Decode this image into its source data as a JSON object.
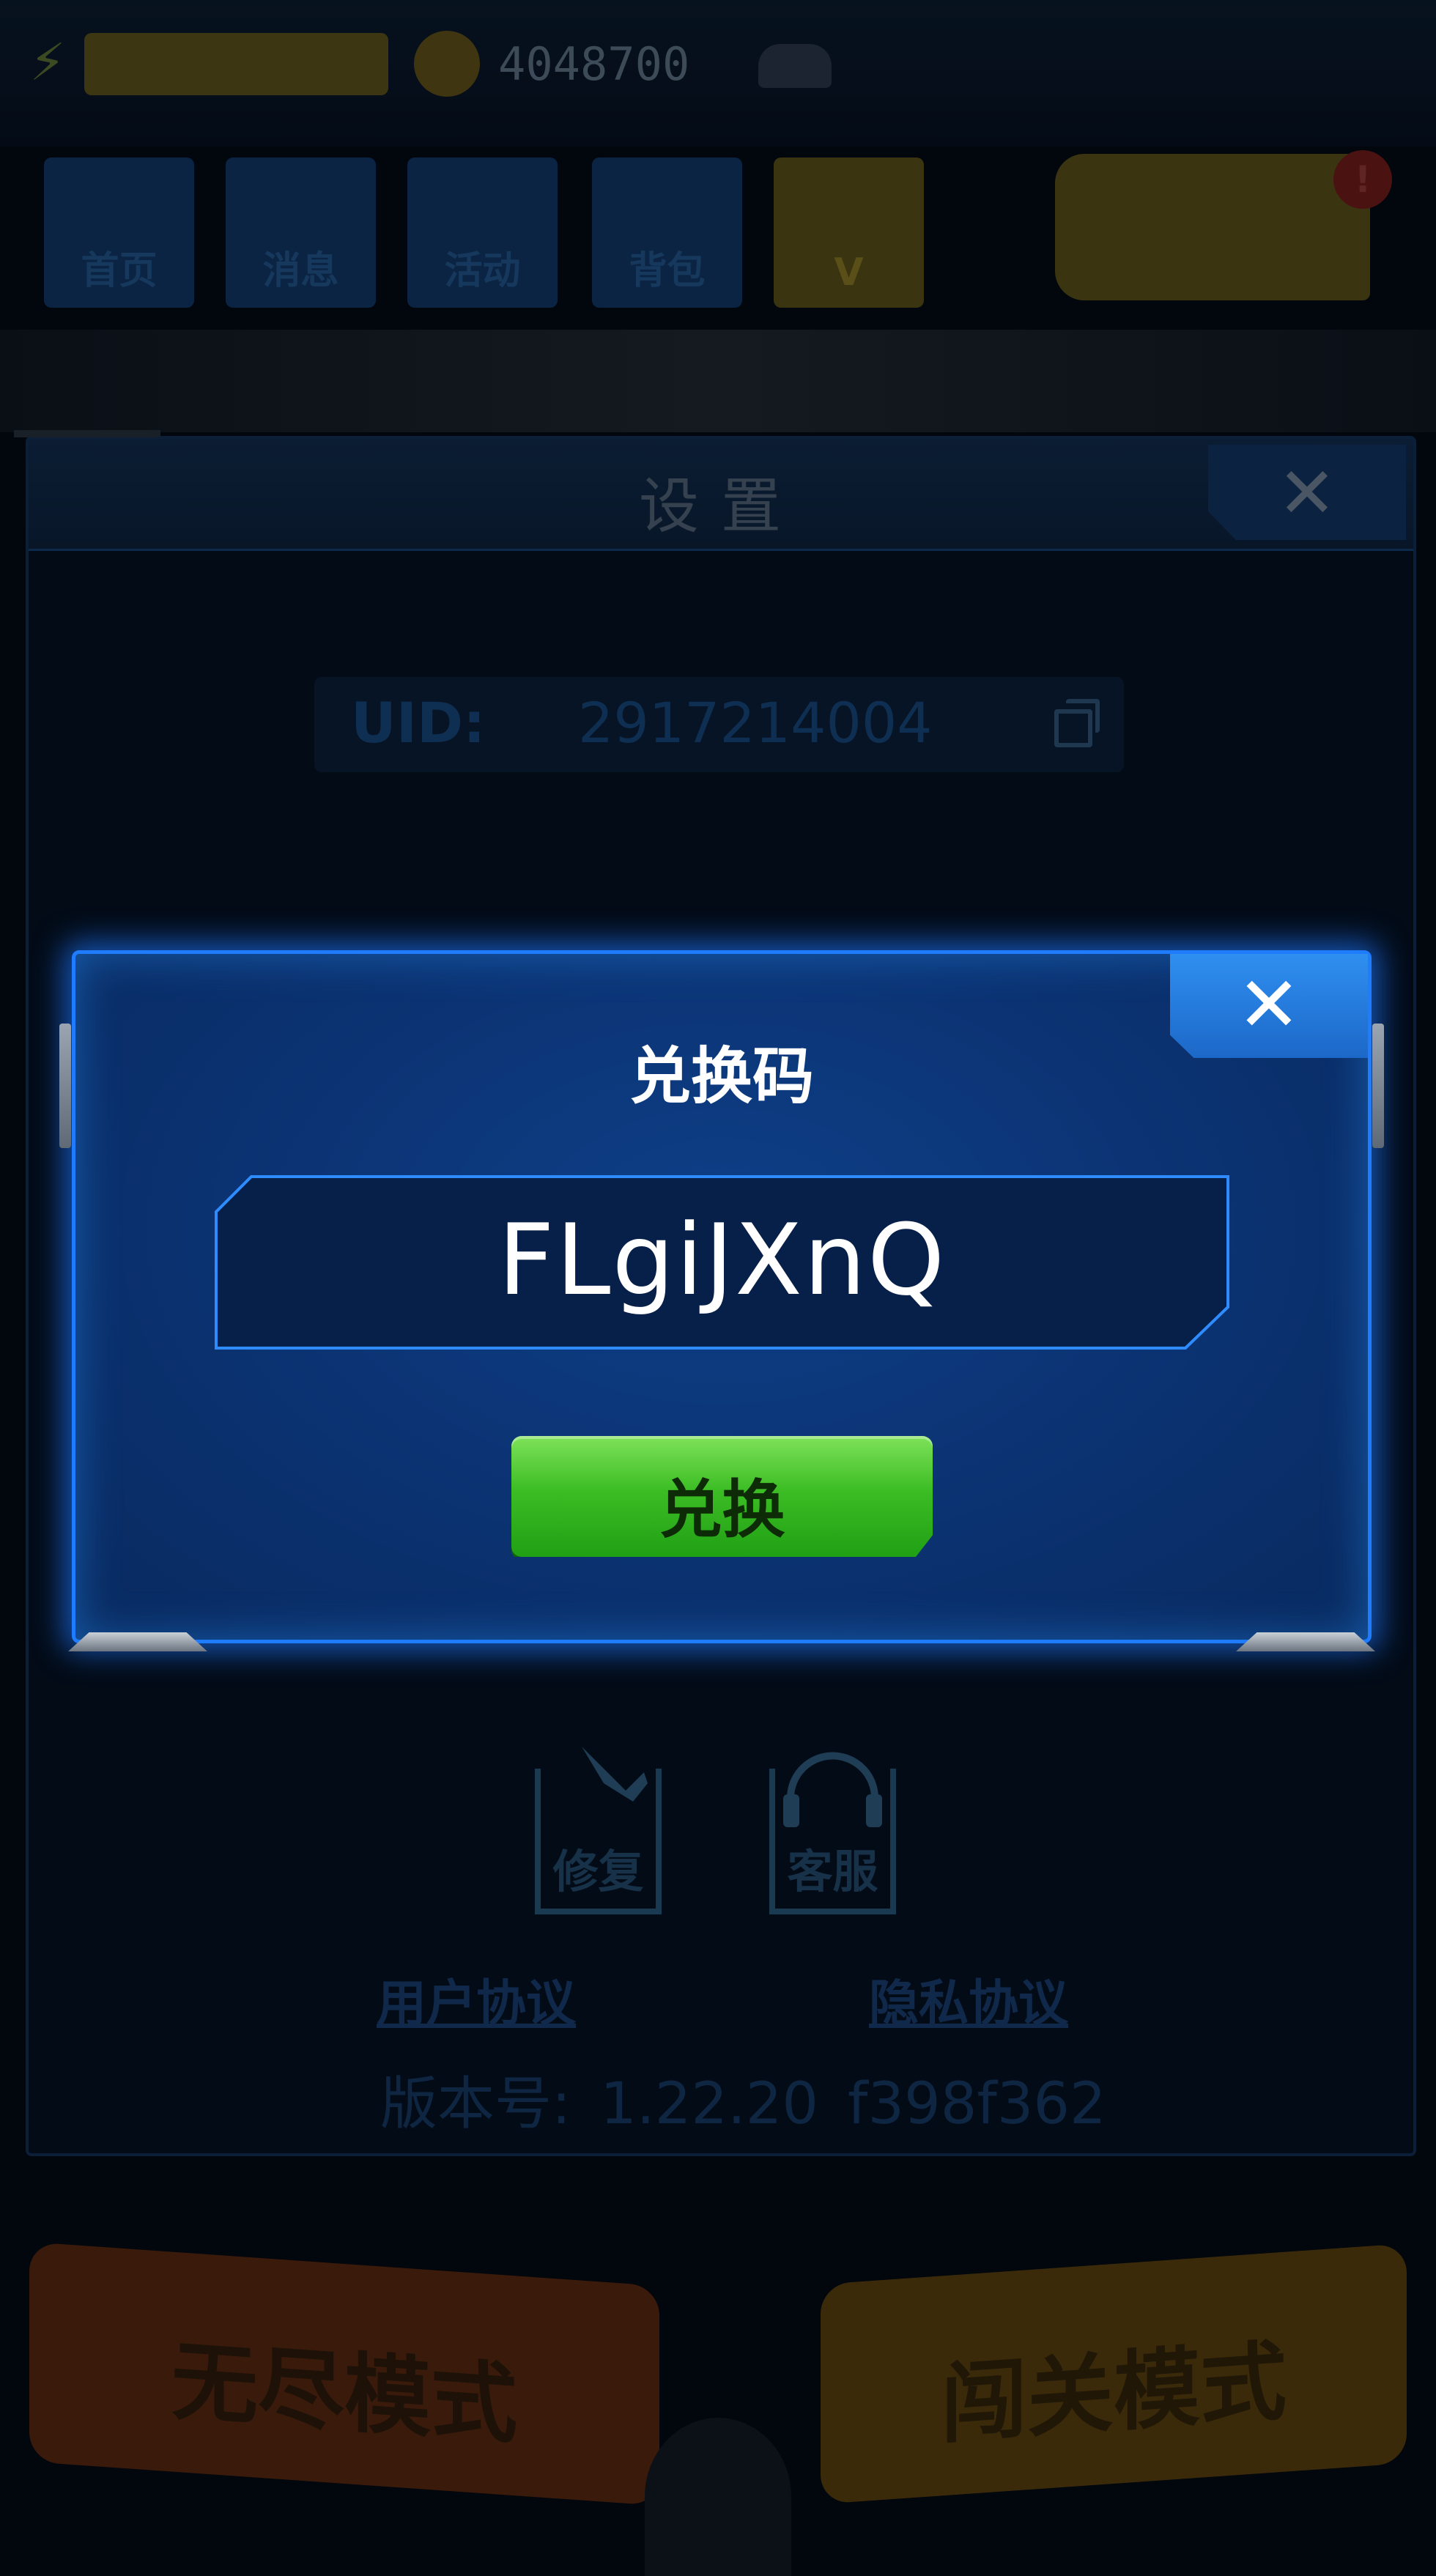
{
  "hud": {
    "coins": "4048700",
    "nav": [
      "首页",
      "消息",
      "活动",
      "背包",
      "V"
    ],
    "badges": [
      "!",
      "!"
    ]
  },
  "modes": {
    "endless": "无尽模式",
    "level": "闯关模式"
  },
  "settings": {
    "title": "设置",
    "close": "✕",
    "uid_label": "UID:",
    "uid_value": "2917214004",
    "repair_label": "修复",
    "service_label": "客服",
    "user_agreement": "用户协议",
    "privacy_agreement": "隐私协议",
    "version_label": "版本号:",
    "version_number": "1.22.20",
    "version_hash": "f398f362"
  },
  "redeem": {
    "title": "兑换码",
    "close": "✕",
    "code_value": "FLgiJXnQ",
    "button_label": "兑换"
  },
  "colors": {
    "dialog_border": "#1f7cff",
    "dialog_bg": "#0b3271",
    "button_green": "#3cbd24"
  }
}
